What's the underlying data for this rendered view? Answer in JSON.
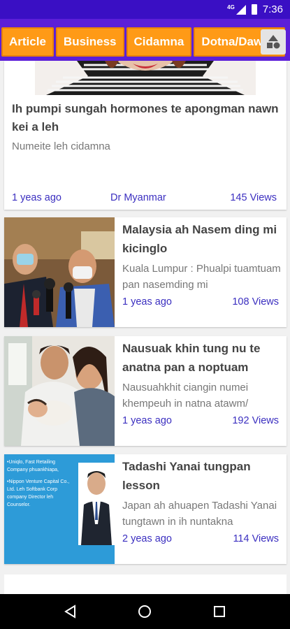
{
  "status_bar": {
    "network": "4G",
    "time": "7:36"
  },
  "tabs": [
    {
      "label": "Article"
    },
    {
      "label": "Business"
    },
    {
      "label": "Cidamna"
    },
    {
      "label": "Dotna/Dawng"
    }
  ],
  "featured": {
    "title": "Ih pumpi sungah hormones te apongman nawn kei a leh",
    "subtitle": "Numeite leh cidamna",
    "time": "1 yeas ago",
    "author": "Dr Myanmar",
    "views": "145 Views"
  },
  "articles": [
    {
      "title": "Malaysia ah Nasem ding mi kicinglo",
      "subtitle": "Kuala Lumpur : Phualpi tuamtuam pan nasemding mi",
      "time": "1 yeas ago",
      "views": "108 Views"
    },
    {
      "title": "Nausuak khin tung nu te anatna pan a noptuam",
      "subtitle": "Nausuahkhit ciangin numei khempeuh in natna atawm/",
      "time": "1 yeas ago",
      "views": "192 Views"
    },
    {
      "title": "Tadashi Yanai tungpan lesson",
      "subtitle": "Japan ah ahuapen Tadashi Yanai tungtawn in ih nuntakna",
      "time": "2 yeas ago",
      "views": "114 Views",
      "image_text": [
        "•Uniqlo, Fast Retailing Company phuankhiapa,",
        "•Nippon Venture Capital Co., Ltd. Leh Softbank Corp company Director leh Counselor."
      ]
    }
  ],
  "colors": {
    "status_bar": "#3a0fc4",
    "tab_bar": "#5c1fd8",
    "tab": "#ff9a16",
    "meta_text": "#3b2fc0"
  }
}
